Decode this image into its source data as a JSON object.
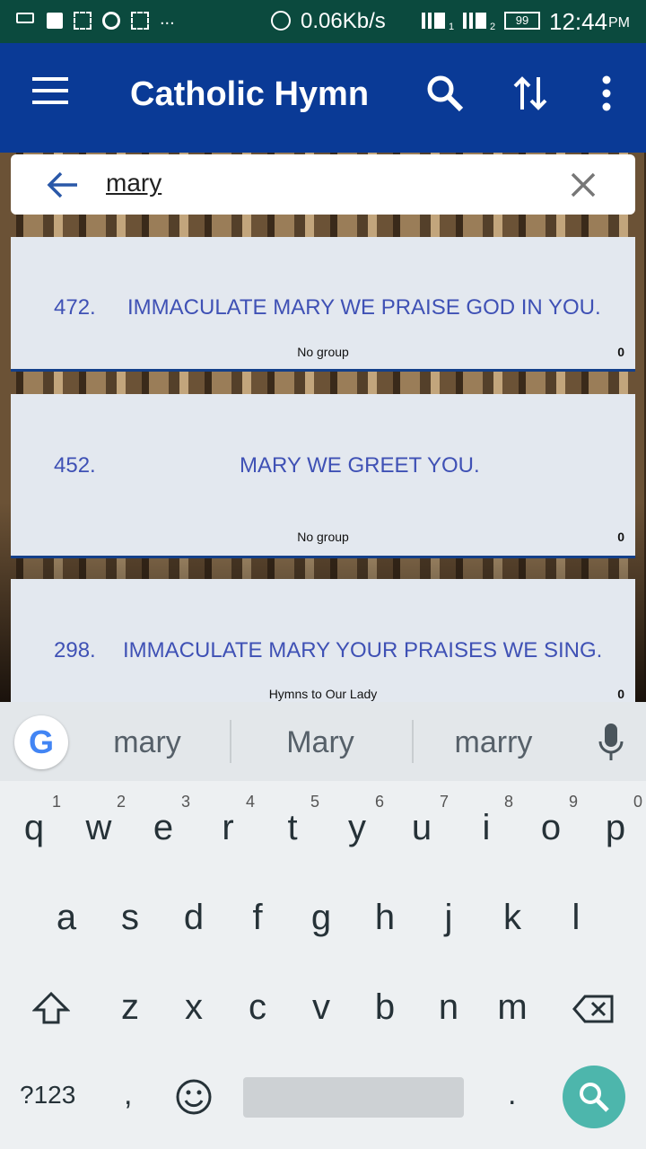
{
  "status": {
    "net_speed": "0.06Kb/s",
    "sim1": "1",
    "sim2": "2",
    "battery": "99",
    "time": "12:44",
    "ampm": "PM",
    "more": "..."
  },
  "appbar": {
    "title": "Catholic Hymn",
    "icons": [
      "search-icon",
      "sort-icon",
      "more-vert-icon"
    ]
  },
  "search": {
    "value": "mary"
  },
  "hymns": [
    {
      "number": "472.",
      "title": "IMMACULATE MARY WE PRAISE GOD IN YOU.",
      "group": "No group",
      "count": "0"
    },
    {
      "number": "452.",
      "title": "MARY WE GREET YOU.",
      "group": "No group",
      "count": "0"
    },
    {
      "number": "298.",
      "title": "IMMACULATE MARY  YOUR PRAISES WE SING.",
      "group": "Hymns to Our Lady",
      "count": "0"
    }
  ],
  "keyboard": {
    "suggestions": [
      "mary",
      "Mary",
      "marry"
    ],
    "row1": [
      [
        "q",
        "1"
      ],
      [
        "w",
        "2"
      ],
      [
        "e",
        "3"
      ],
      [
        "r",
        "4"
      ],
      [
        "t",
        "5"
      ],
      [
        "y",
        "6"
      ],
      [
        "u",
        "7"
      ],
      [
        "i",
        "8"
      ],
      [
        "o",
        "9"
      ],
      [
        "p",
        "0"
      ]
    ],
    "row2": [
      "a",
      "s",
      "d",
      "f",
      "g",
      "h",
      "j",
      "k",
      "l"
    ],
    "row3": [
      "z",
      "x",
      "c",
      "v",
      "b",
      "n",
      "m"
    ],
    "symbols": "?123",
    "comma": ",",
    "period": ".",
    "accent": "#4db6ac"
  }
}
